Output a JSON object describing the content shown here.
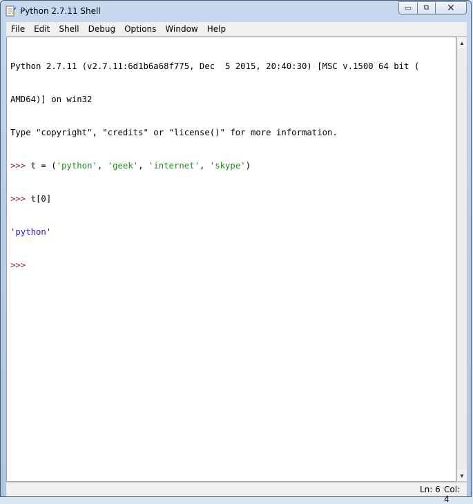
{
  "window": {
    "title": "Python 2.7.11 Shell",
    "buttons": {
      "minimize": "▭",
      "maximize": "⧉",
      "close": "✕"
    }
  },
  "menu": [
    "File",
    "Edit",
    "Shell",
    "Debug",
    "Options",
    "Window",
    "Help"
  ],
  "shell": {
    "banner_line1": "Python 2.7.11 (v2.7.11:6d1b6a68f775, Dec  5 2015, 20:40:30) [MSC v.1500 64 bit (",
    "banner_line2": "AMD64)] on win32",
    "banner_line3": "Type \"copyright\", \"credits\" or \"license()\" for more information.",
    "prompt": ">>> ",
    "cmd1_prefix": "t = (",
    "cmd1_str1": "'python'",
    "sep": ", ",
    "cmd1_str2": "'geek'",
    "cmd1_str3": "'internet'",
    "cmd1_str4": "'skype'",
    "cmd1_suffix": ")",
    "cmd2": "t[0]",
    "result": "'python'",
    "last_prompt": ">>>"
  },
  "status": {
    "line": "Ln: 6",
    "col": "Col: 4"
  },
  "colors": {
    "prompt": "#8b1a1a",
    "string": "#1a8f1a",
    "result": "#1c1ce0"
  }
}
